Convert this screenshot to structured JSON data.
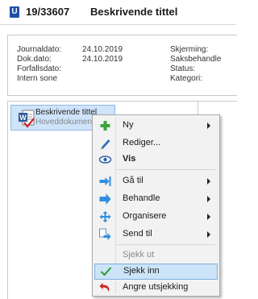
{
  "header": {
    "badge": "U",
    "number": "19/33607",
    "title": "Beskrivende tittel"
  },
  "meta": {
    "journaldato_label": "Journaldato:",
    "journaldato_value": "24.10.2019",
    "dokdato_label": "Dok.dato:",
    "dokdato_value": "24.10.2019",
    "forfallsdato_label": "Forfallsdato:",
    "intern_sone_label": "Intern sone",
    "skjerming_label": "Skjerming:",
    "saksbehandler_label": "Saksbehandle",
    "status_label": "Status:",
    "kategori_label": "Kategori:"
  },
  "document_row": {
    "title": "Beskrivende tittel",
    "subtitle": "Hoveddokument"
  },
  "context_menu": {
    "items": [
      {
        "label": "Ny",
        "icon": "plus-icon",
        "submenu": true
      },
      {
        "label": "Rediger...",
        "icon": "pencil-icon",
        "submenu": false
      },
      {
        "label": "Vis",
        "icon": "eye-icon",
        "submenu": false,
        "bold": true
      },
      {
        "label": "Gå til",
        "icon": "go-to-icon",
        "submenu": true
      },
      {
        "label": "Behandle",
        "icon": "process-arrow-icon",
        "submenu": true
      },
      {
        "label": "Organisere",
        "icon": "organize-icon",
        "submenu": true
      },
      {
        "label": "Send til",
        "icon": "send-to-icon",
        "submenu": true
      },
      {
        "label": "Sjekk ut",
        "icon": "",
        "submenu": false,
        "disabled": true
      },
      {
        "label": "Sjekk inn",
        "icon": "checkmark-icon",
        "submenu": false,
        "highlighted": true
      },
      {
        "label": "Angre utsjekking",
        "icon": "undo-icon",
        "submenu": false
      }
    ]
  },
  "colors": {
    "badge": "#1f4fa8",
    "selection": "#cfe3fa",
    "menu_bg": "#f2f2f2",
    "menu_highlight": "#cce4f7",
    "plus_green": "#3aa53a",
    "check_green": "#2e9a2e",
    "undo_red": "#d42020",
    "arrow_blue": "#2f8ee0"
  }
}
